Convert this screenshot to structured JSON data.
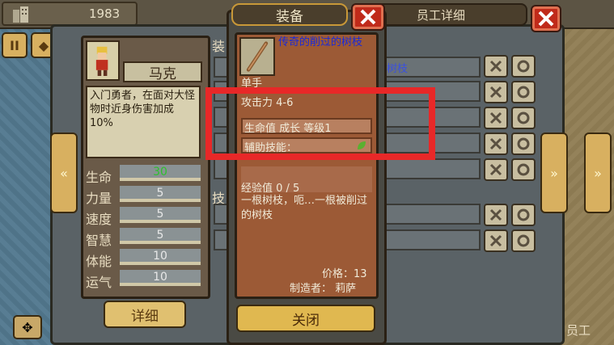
{
  "topbar": {
    "money": "1983"
  },
  "back_panel": {
    "tab_title": "员工详细"
  },
  "character": {
    "name": "马克",
    "description": "入门勇者，在面对大怪物时近身伤害加成10%",
    "stats": [
      {
        "label": "生命",
        "value": "30",
        "color": "#2ec02e"
      },
      {
        "label": "力量",
        "value": "5"
      },
      {
        "label": "速度",
        "value": "5"
      },
      {
        "label": "智慧",
        "value": "5"
      },
      {
        "label": "体能",
        "value": "10"
      },
      {
        "label": "运气",
        "value": "10"
      }
    ],
    "detail_label": "详细"
  },
  "list": {
    "side_label_1": "装",
    "side_label_2": "技",
    "row1_text": "树枝"
  },
  "equipment": {
    "title": "装备",
    "item_name": "传奇的削过的树枝",
    "hand_type": "单手",
    "attack": "攻击力 4-6",
    "growth": "生命值 成长 等级1",
    "support_skill": "辅助技能：",
    "experience": "经验值 0 / 5",
    "flavor": "一根树枝，呃…一根被削过的树枝",
    "price": "价格：13",
    "maker": "制造者： 莉萨",
    "close_label": "关闭"
  },
  "bottom": {
    "staff_label": "员工"
  },
  "colors": {
    "highlight": "#e82828",
    "item_name": "#1a2ad8",
    "accent": "#e0b850"
  }
}
